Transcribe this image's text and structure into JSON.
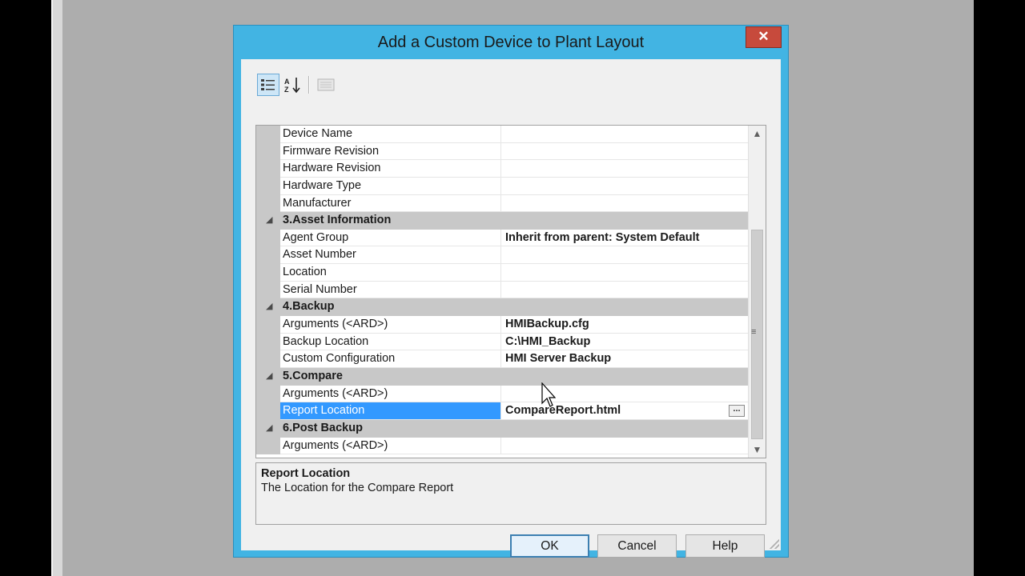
{
  "dialog": {
    "title": "Add a Custom Device to Plant Layout",
    "close_label": "✕"
  },
  "toolbar": {
    "buttons": [
      "categorized-icon",
      "alphabetical-sort-icon",
      "property-pages-icon"
    ]
  },
  "property_grid": {
    "rows": [
      {
        "type": "prop",
        "name": "Device Name",
        "value": ""
      },
      {
        "type": "prop",
        "name": "Firmware Revision",
        "value": ""
      },
      {
        "type": "prop",
        "name": "Hardware Revision",
        "value": ""
      },
      {
        "type": "prop",
        "name": "Hardware Type",
        "value": ""
      },
      {
        "type": "prop",
        "name": "Manufacturer",
        "value": ""
      },
      {
        "type": "cat",
        "name": "3.Asset Information"
      },
      {
        "type": "prop",
        "name": "Agent Group",
        "value": "Inherit from parent: System Default"
      },
      {
        "type": "prop",
        "name": "Asset Number",
        "value": ""
      },
      {
        "type": "prop",
        "name": "Location",
        "value": ""
      },
      {
        "type": "prop",
        "name": "Serial Number",
        "value": ""
      },
      {
        "type": "cat",
        "name": "4.Backup"
      },
      {
        "type": "prop",
        "name": "Arguments (<ARD>)",
        "value": "HMIBackup.cfg"
      },
      {
        "type": "prop",
        "name": "Backup Location",
        "value": "C:\\HMI_Backup"
      },
      {
        "type": "prop",
        "name": "Custom Configuration",
        "value": "HMI Server Backup"
      },
      {
        "type": "cat",
        "name": "5.Compare"
      },
      {
        "type": "prop",
        "name": "Arguments (<ARD>)",
        "value": ""
      },
      {
        "type": "prop",
        "name": "Report Location",
        "value": "CompareReport.html",
        "selected": true,
        "ellipsis": "..."
      },
      {
        "type": "cat",
        "name": "6.Post Backup"
      },
      {
        "type": "prop",
        "name": "Arguments (<ARD>)",
        "value": ""
      }
    ]
  },
  "description": {
    "title": "Report Location",
    "text": "The Location for the Compare Report"
  },
  "buttons": {
    "ok": "OK",
    "cancel": "Cancel",
    "help": "Help"
  },
  "colors": {
    "title_bar": "#42b4e3",
    "close_button": "#c74a3c",
    "selection": "#3399ff"
  }
}
